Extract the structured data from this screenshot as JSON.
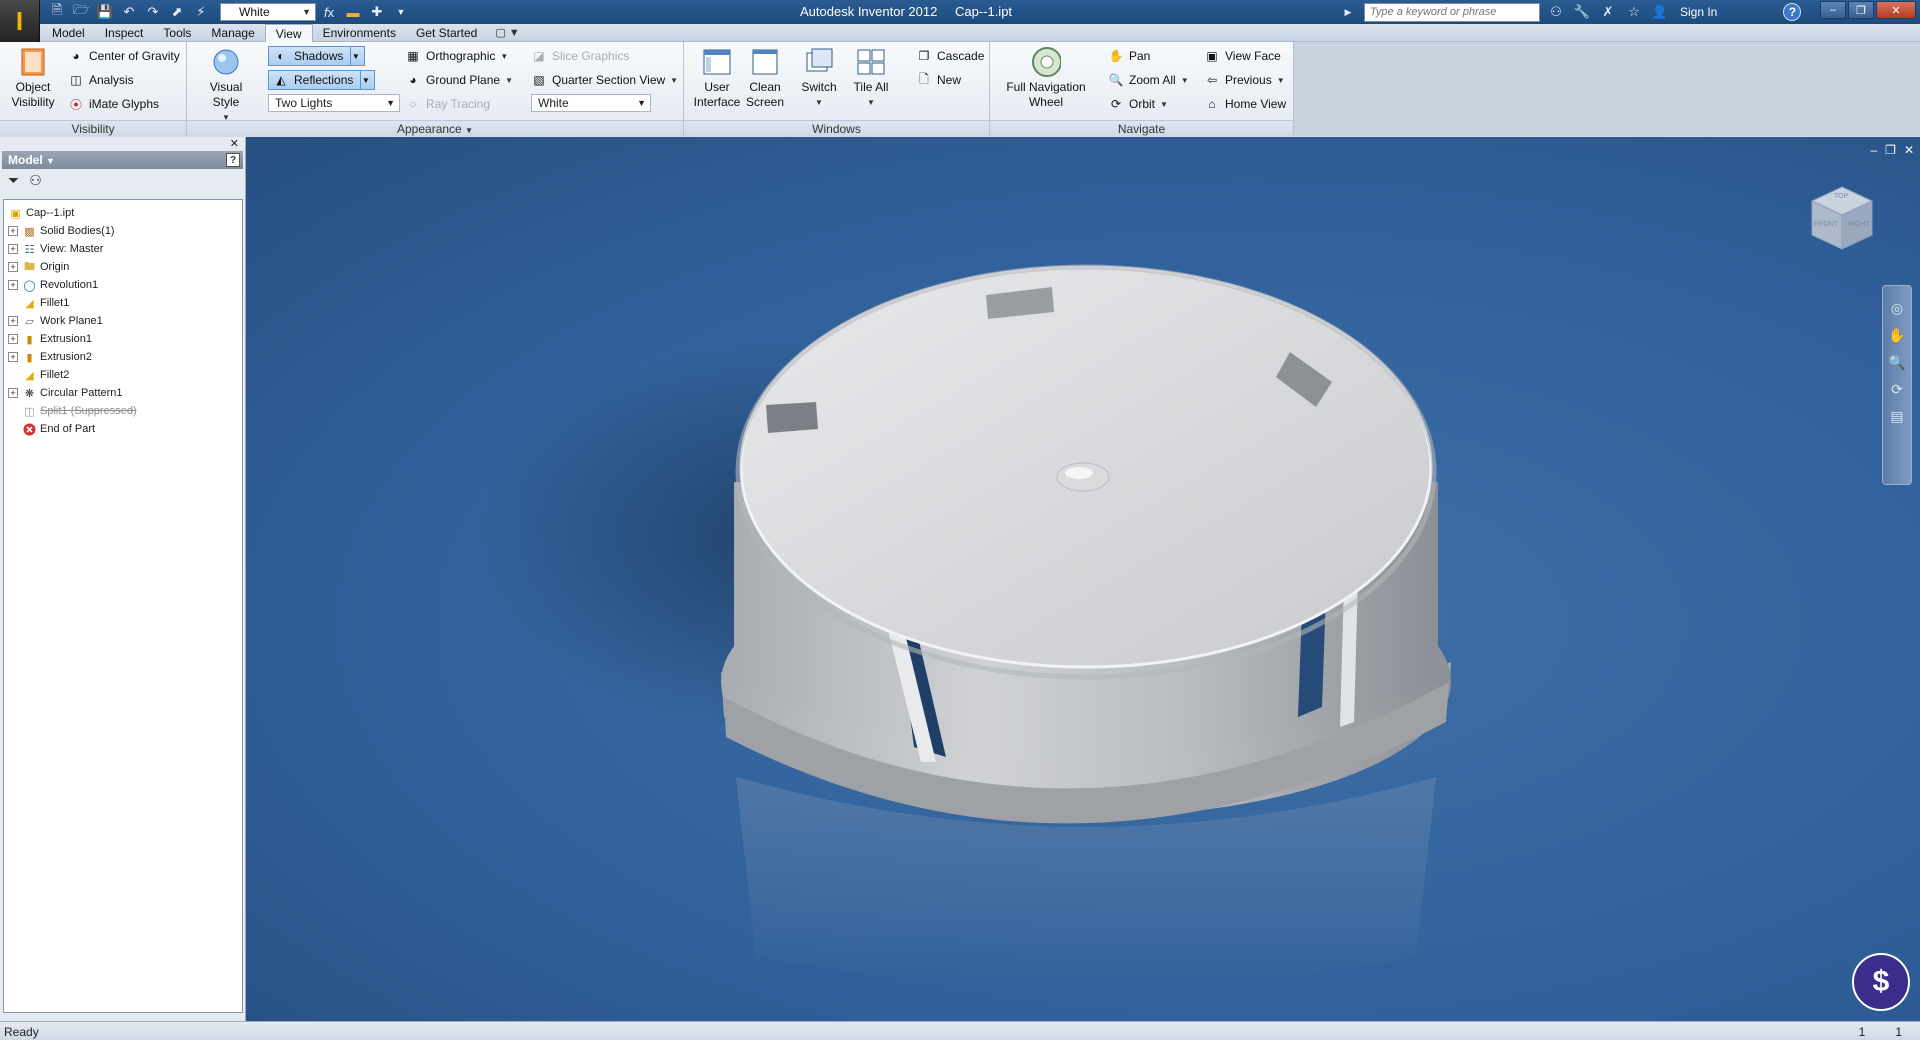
{
  "app": {
    "title": "Autodesk Inventor 2012",
    "document": "Cap--1.ipt",
    "logo_glyph": "I"
  },
  "qat": {
    "material_select": "White",
    "icons": [
      "new-icon",
      "open-icon",
      "save-icon",
      "undo-icon",
      "redo-icon",
      "select-icon",
      "update-icon",
      "fx-icon",
      "color-icon",
      "plus-icon"
    ]
  },
  "search": {
    "placeholder": "Type a keyword or phrase",
    "sign_in": "Sign In"
  },
  "tabs": [
    "Model",
    "Inspect",
    "Tools",
    "Manage",
    "View",
    "Environments",
    "Get Started"
  ],
  "active_tab": "View",
  "ribbon": {
    "visibility": {
      "title": "Visibility",
      "object_visibility": "Object\nVisibility",
      "center_of_gravity": "Center of Gravity",
      "analysis": "Analysis",
      "imate_glyphs": "iMate Glyphs"
    },
    "appearance": {
      "title": "Appearance",
      "visual_style": "Visual Style",
      "shadows": "Shadows",
      "reflections": "Reflections",
      "lighting": "Two Lights",
      "orthographic": "Orthographic",
      "ground_plane": "Ground Plane",
      "ray_tracing": "Ray Tracing",
      "slice_graphics": "Slice Graphics",
      "quarter_section_view": "Quarter Section View",
      "color_override": "White"
    },
    "windows": {
      "title": "Windows",
      "user_interface": "User\nInterface",
      "clean_screen": "Clean\nScreen",
      "switch": "Switch",
      "tile_all": "Tile All",
      "cascade": "Cascade",
      "new": "New"
    },
    "navigate": {
      "title": "Navigate",
      "full_navigation_wheel": "Full Navigation\nWheel",
      "pan": "Pan",
      "zoom_all": "Zoom All",
      "orbit": "Orbit",
      "view_face": "View Face",
      "previous": "Previous",
      "home_view": "Home View"
    }
  },
  "browser": {
    "title": "Model",
    "tree": [
      {
        "label": "Cap--1.ipt",
        "icon": "part-icon",
        "expand": false,
        "suppressed": false
      },
      {
        "label": "Solid Bodies(1)",
        "icon": "solid-bodies-icon",
        "expand": true,
        "suppressed": false
      },
      {
        "label": "View: Master",
        "icon": "view-icon",
        "expand": true,
        "suppressed": false
      },
      {
        "label": "Origin",
        "icon": "folder-icon",
        "expand": true,
        "suppressed": false
      },
      {
        "label": "Revolution1",
        "icon": "revolve-icon",
        "expand": true,
        "suppressed": false
      },
      {
        "label": "Fillet1",
        "icon": "fillet-icon",
        "expand": false,
        "suppressed": false
      },
      {
        "label": "Work Plane1",
        "icon": "work-plane-icon",
        "expand": true,
        "suppressed": false
      },
      {
        "label": "Extrusion1",
        "icon": "extrude-icon",
        "expand": true,
        "suppressed": false
      },
      {
        "label": "Extrusion2",
        "icon": "extrude-icon",
        "expand": true,
        "suppressed": false
      },
      {
        "label": "Fillet2",
        "icon": "fillet-icon",
        "expand": false,
        "suppressed": false
      },
      {
        "label": "Circular Pattern1",
        "icon": "circular-pattern-icon",
        "expand": true,
        "suppressed": false
      },
      {
        "label": "Split1 (Suppressed)",
        "icon": "split-icon",
        "expand": false,
        "suppressed": true
      },
      {
        "label": "End of Part",
        "icon": "end-of-part-icon",
        "expand": false,
        "suppressed": false
      }
    ]
  },
  "viewcube": {
    "top": "TOP",
    "front": "FRONT",
    "right": "RIGHT"
  },
  "status": {
    "text": "Ready",
    "count_a": "1",
    "count_b": "1"
  },
  "colors": {
    "viewport_bg": "#30609a",
    "titlebar": "#1c4a7c",
    "part_gray": "#c7c9cc"
  }
}
